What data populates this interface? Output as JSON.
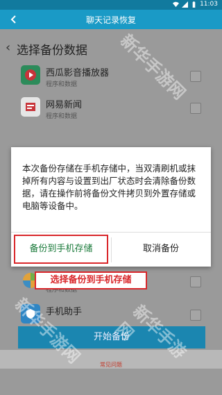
{
  "status_bar": {
    "time": "11:03"
  },
  "app_bar": {
    "title": "聊天记录恢复"
  },
  "section": {
    "title": "选择备份数据"
  },
  "apps": [
    {
      "name": "西瓜影音播放器",
      "sub": "程序和数据"
    },
    {
      "name": "网易新闻",
      "sub": "程序和数据"
    },
    {
      "name": "",
      "sub": "程序和数据"
    },
    {
      "name": "手机助手",
      "sub": ""
    }
  ],
  "dialog": {
    "message": "本次备份存储在手机存储中，当双清刷机或抹掉所有内容与设置到出厂状态时会清除备份数据，请在操作前将备份文件拷贝到外置存储或电脑等设备中。",
    "backup_label": "备份到手机存储",
    "cancel_label": "取消备份"
  },
  "annotation": {
    "text": "选择备份到手机存储"
  },
  "start_button": {
    "label": "开始备份"
  },
  "faq": {
    "label": "常见问题"
  },
  "watermark": {
    "text": "新华手游网"
  },
  "colors": {
    "status_bar": "#117a9e",
    "app_bar": "#1a9ac6",
    "highlight": "#d9262a",
    "backup_text": "#1a7a3a"
  }
}
